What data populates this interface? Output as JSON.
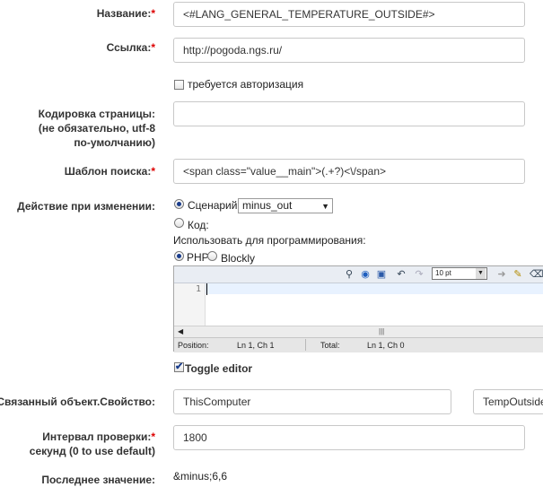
{
  "fields": {
    "name": {
      "label": "Название:",
      "req": "*",
      "value": "<#LANG_GENERAL_TEMPERATURE_OUTSIDE#>"
    },
    "link": {
      "label": "Ссылка:",
      "req": "*",
      "value": "http://pogoda.ngs.ru/"
    },
    "auth": {
      "label": "требуется авторизация",
      "checked": false
    },
    "encoding": {
      "line1": "Кодировка страницы:",
      "line2": "(не обязательно, utf-8",
      "line3": "по-умолчанию)",
      "value": ""
    },
    "pattern": {
      "label": "Шаблон поиска:",
      "req": "*",
      "value": "<span class=\"value__main\">(.+?)<\\/span>"
    },
    "action": {
      "label": "Действие при изменении:",
      "script_label": "Сценарий:",
      "script_value": "minus_out",
      "code_label": "Код:",
      "use_for_programming": "Использовать для программирования:",
      "php_label": "PHP",
      "blockly_label": "Blockly",
      "selected": "script"
    },
    "editor": {
      "font_size": "10 pt",
      "line_number": "1",
      "status_position_label": "Position:",
      "status_position_value": "Ln 1, Ch 1",
      "status_total_label": "Total:",
      "status_total_value": "Ln 1, Ch 0",
      "toggle_label": "Toggle editor",
      "toggle_checked": true
    },
    "linked": {
      "label": "Связанный объект.Свойство:",
      "object": "ThisComputer",
      "property": "TempOutside"
    },
    "interval": {
      "line1": "Интервал проверки:",
      "req": "*",
      "line2": "секунд (0 to use default)",
      "value": "1800"
    },
    "last_value": {
      "label": "Последнее значение:",
      "value": "&minus;6,6"
    }
  }
}
